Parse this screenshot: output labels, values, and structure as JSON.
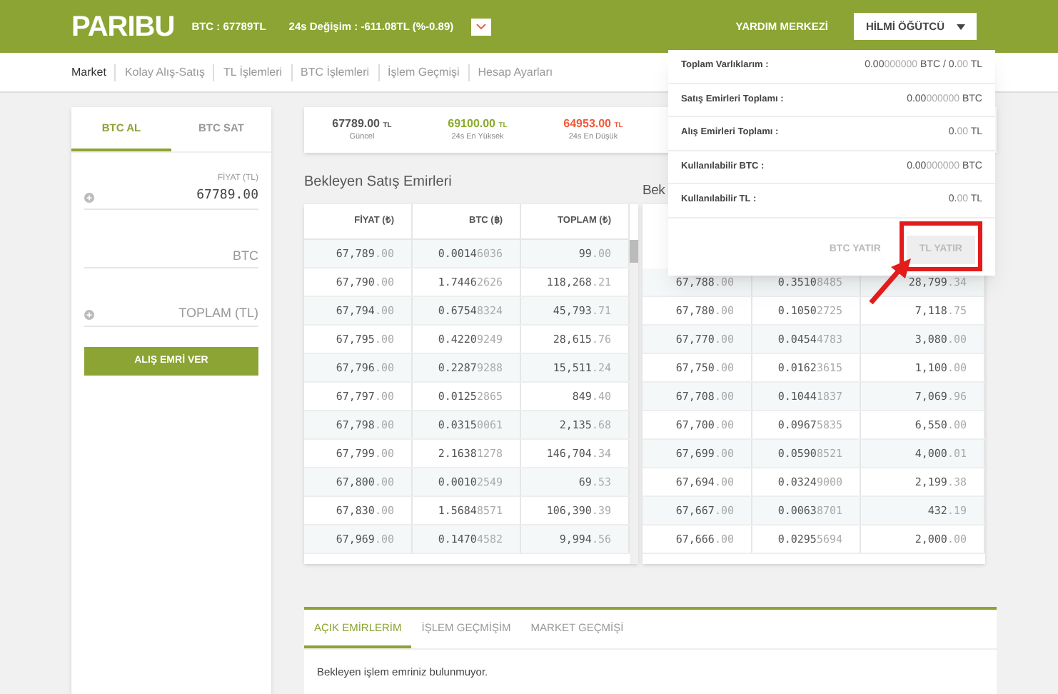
{
  "header": {
    "logo": "PARIBU",
    "ticker": "BTC : 67789TL",
    "change": "24s Değişim : -611.08TL (%-0.89)",
    "help": "YARDIM MERKEZİ",
    "user": "HİLMİ ÖĞÜTCÜ"
  },
  "nav": [
    {
      "label": "Market",
      "selected": true
    },
    {
      "label": "Kolay Alış-Satış",
      "selected": false
    },
    {
      "label": "TL İşlemleri",
      "selected": false
    },
    {
      "label": "BTC İşlemleri",
      "selected": false
    },
    {
      "label": "İşlem Geçmişi",
      "selected": false
    },
    {
      "label": "Hesap Ayarları",
      "selected": false
    }
  ],
  "order_form": {
    "tabs": [
      {
        "label": "BTC AL",
        "selected": true
      },
      {
        "label": "BTC SAT",
        "selected": false
      }
    ],
    "price_label": "FİYAT (TL)",
    "price_value": "67789.00",
    "amount_placeholder": "BTC",
    "total_placeholder": "TOPLAM (TL)",
    "submit": "ALIŞ EMRİ VER"
  },
  "stats": [
    {
      "value": "67789.00",
      "unit": "TL",
      "label": "Güncel",
      "color": "#555555"
    },
    {
      "value": "69100.00",
      "unit": "TL",
      "label": "24s En Yüksek",
      "color": "#8aab2a"
    },
    {
      "value": "64953.00",
      "unit": "TL",
      "label": "24s En Düşük",
      "color": "#f05a3c"
    }
  ],
  "sell_orders": {
    "title": "Bekleyen Satış Emirleri",
    "columns": [
      "FİYAT (₺)",
      "BTC (฿)",
      "TOPLAM (₺)"
    ],
    "rows": [
      [
        [
          "67,789",
          ".00"
        ],
        [
          "0.0014",
          "6036"
        ],
        [
          "99",
          ".00"
        ]
      ],
      [
        [
          "67,790",
          ".00"
        ],
        [
          "1.7446",
          "2626"
        ],
        [
          "118,268",
          ".21"
        ]
      ],
      [
        [
          "67,794",
          ".00"
        ],
        [
          "0.6754",
          "8324"
        ],
        [
          "45,793",
          ".71"
        ]
      ],
      [
        [
          "67,795",
          ".00"
        ],
        [
          "0.4220",
          "9249"
        ],
        [
          "28,615",
          ".76"
        ]
      ],
      [
        [
          "67,796",
          ".00"
        ],
        [
          "0.2287",
          "9288"
        ],
        [
          "15,511",
          ".24"
        ]
      ],
      [
        [
          "67,797",
          ".00"
        ],
        [
          "0.0125",
          "2865"
        ],
        [
          "849",
          ".40"
        ]
      ],
      [
        [
          "67,798",
          ".00"
        ],
        [
          "0.0315",
          "0061"
        ],
        [
          "2,135",
          ".68"
        ]
      ],
      [
        [
          "67,799",
          ".00"
        ],
        [
          "2.1638",
          "1278"
        ],
        [
          "146,704",
          ".34"
        ]
      ],
      [
        [
          "67,800",
          ".00"
        ],
        [
          "0.0010",
          "2549"
        ],
        [
          "69",
          ".53"
        ]
      ],
      [
        [
          "67,830",
          ".00"
        ],
        [
          "1.5684",
          "8571"
        ],
        [
          "106,390",
          ".39"
        ]
      ],
      [
        [
          "67,969",
          ".00"
        ],
        [
          "0.1470",
          "4582"
        ],
        [
          "9,994",
          ".56"
        ]
      ]
    ]
  },
  "buy_orders": {
    "title": "Bek",
    "rows": [
      [
        [
          "67,788",
          ".00"
        ],
        [
          "0.3510",
          "8485"
        ],
        [
          "28,799",
          ".34"
        ]
      ],
      [
        [
          "67,780",
          ".00"
        ],
        [
          "0.1050",
          "2725"
        ],
        [
          "7,118",
          ".75"
        ]
      ],
      [
        [
          "67,770",
          ".00"
        ],
        [
          "0.0454",
          "4783"
        ],
        [
          "3,080",
          ".00"
        ]
      ],
      [
        [
          "67,750",
          ".00"
        ],
        [
          "0.0162",
          "3615"
        ],
        [
          "1,100",
          ".00"
        ]
      ],
      [
        [
          "67,708",
          ".00"
        ],
        [
          "0.1044",
          "1837"
        ],
        [
          "7,069",
          ".96"
        ]
      ],
      [
        [
          "67,700",
          ".00"
        ],
        [
          "0.0967",
          "5835"
        ],
        [
          "6,550",
          ".00"
        ]
      ],
      [
        [
          "67,699",
          ".00"
        ],
        [
          "0.0590",
          "8521"
        ],
        [
          "4,000",
          ".01"
        ]
      ],
      [
        [
          "67,694",
          ".00"
        ],
        [
          "0.0324",
          "9000"
        ],
        [
          "2,199",
          ".38"
        ]
      ],
      [
        [
          "67,667",
          ".00"
        ],
        [
          "0.0063",
          "8701"
        ],
        [
          "432",
          ".19"
        ]
      ],
      [
        [
          "67,666",
          ".00"
        ],
        [
          "0.0295",
          "5694"
        ],
        [
          "2,000",
          ".00"
        ]
      ]
    ]
  },
  "history": {
    "tabs": [
      {
        "label": "AÇIK EMİRLERİM",
        "selected": true
      },
      {
        "label": "İŞLEM GEÇMİŞİM",
        "selected": false
      },
      {
        "label": "MARKET GEÇMİŞİ",
        "selected": false
      }
    ],
    "message": "Bekleyen işlem emriniz bulunmuyor."
  },
  "account_menu": {
    "rows": [
      {
        "label": "Toplam Varlıklarım :",
        "value": [
          {
            "text": "0.00",
            "dim": false
          },
          {
            "text": "000000",
            "dim": true
          },
          {
            "text": " BTC / 0.",
            "dim": false
          },
          {
            "text": "00",
            "dim": true
          },
          {
            "text": " TL",
            "dim": false
          }
        ]
      },
      {
        "label": "Satış Emirleri Toplamı :",
        "value": [
          {
            "text": "0.00",
            "dim": false
          },
          {
            "text": "000000",
            "dim": true
          },
          {
            "text": " BTC",
            "dim": false
          }
        ]
      },
      {
        "label": "Alış Emirleri Toplamı :",
        "value": [
          {
            "text": "0.",
            "dim": false
          },
          {
            "text": "00",
            "dim": true
          },
          {
            "text": " TL",
            "dim": false
          }
        ]
      },
      {
        "label": "Kullanılabilir BTC :",
        "value": [
          {
            "text": "0.00",
            "dim": false
          },
          {
            "text": "000000",
            "dim": true
          },
          {
            "text": " BTC",
            "dim": false
          }
        ]
      },
      {
        "label": "Kullanılabilir TL :",
        "value": [
          {
            "text": "0.",
            "dim": false
          },
          {
            "text": "00",
            "dim": true
          },
          {
            "text": " TL",
            "dim": false
          }
        ]
      }
    ],
    "buttons": [
      {
        "label": "BTC YATIR",
        "highlighted": false
      },
      {
        "label": "TL YATIR",
        "highlighted": true
      }
    ]
  }
}
